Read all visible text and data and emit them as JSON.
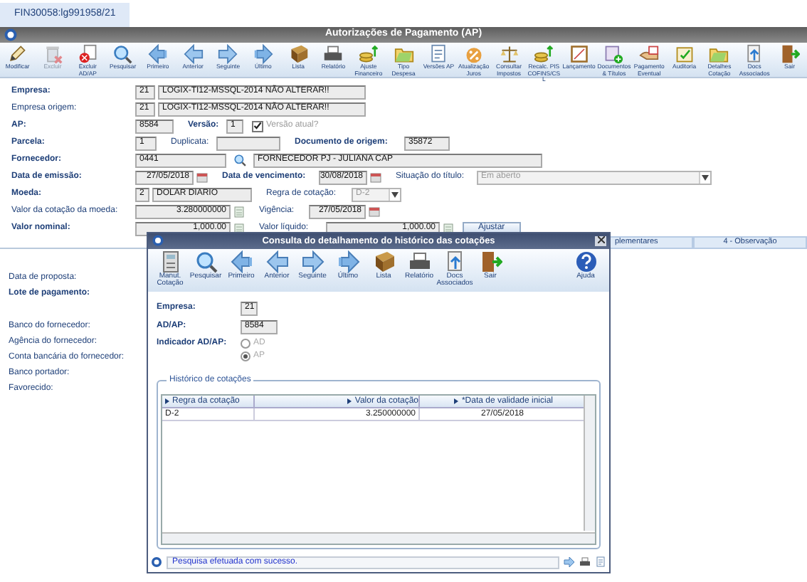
{
  "app_tab": {
    "label": "FIN30058:lg991958/21",
    "selected": true
  },
  "window": {
    "title": "Autorizações de Pagamento (AP)"
  },
  "toolbar": [
    {
      "label": "Modificar",
      "disabled": false
    },
    {
      "label": "Excluir",
      "disabled": true
    },
    {
      "label": "Excluir AD/AP",
      "disabled": false
    },
    {
      "label": "Pesquisar",
      "disabled": false
    },
    {
      "label": "Primeiro",
      "disabled": false
    },
    {
      "label": "Anterior",
      "disabled": false
    },
    {
      "label": "Seguinte",
      "disabled": false
    },
    {
      "label": "Último",
      "disabled": false
    },
    {
      "label": "Lista",
      "disabled": false
    },
    {
      "label": "Relatório",
      "disabled": false
    },
    {
      "label": "Ajuste Financeiro",
      "disabled": false
    },
    {
      "label": "Tipo Despesa",
      "disabled": false
    },
    {
      "label": "Versões AP",
      "disabled": false
    },
    {
      "label": "Atualização Juros",
      "disabled": false
    },
    {
      "label": "Consultar Impostos",
      "disabled": false
    },
    {
      "label": "Recalc. PIS COFINS/CSL",
      "disabled": false
    },
    {
      "label": "Lançamento",
      "disabled": false
    },
    {
      "label": "Documentos & Títulos",
      "disabled": false
    },
    {
      "label": "Pagamento Eventual",
      "disabled": false
    },
    {
      "label": "Auditoria",
      "disabled": false
    },
    {
      "label": "Detalhes Cotação",
      "disabled": false
    },
    {
      "label": "Docs Associados",
      "disabled": false
    },
    {
      "label": "Sair",
      "disabled": false
    }
  ],
  "form": [
    {
      "items": [
        {
          "kind": "label",
          "text": "Empresa:",
          "required": true
        },
        {
          "kind": "field",
          "value": "21"
        },
        {
          "kind": "field",
          "value": "LOGIX-TI12-MSSQL-2014 NÃO ALTERAR!!"
        }
      ]
    },
    {
      "items": [
        {
          "kind": "label",
          "text": "Empresa origem:",
          "required": false
        },
        {
          "kind": "field",
          "value": "21"
        },
        {
          "kind": "field",
          "value": "LOGIX-TI12-MSSQL-2014 NÃO ALTERAR!!"
        }
      ]
    },
    {
      "items": [
        {
          "kind": "label",
          "text": "AP:",
          "required": true
        },
        {
          "kind": "field",
          "value": "8584"
        },
        {
          "kind": "label",
          "text": "Versão:",
          "required": true
        },
        {
          "kind": "field",
          "value": "1"
        },
        {
          "kind": "checkbox",
          "checked": true
        },
        {
          "kind": "caption",
          "text": "Versão atual?",
          "disabled": true
        }
      ]
    },
    {
      "items": [
        {
          "kind": "label",
          "text": "Parcela:",
          "required": true
        },
        {
          "kind": "field",
          "value": "1"
        },
        {
          "kind": "label",
          "text": "Duplicata:",
          "required": false
        },
        {
          "kind": "field"
        },
        {
          "kind": "label",
          "text": "Documento de origem:",
          "required": true
        },
        {
          "kind": "field",
          "value": "35872"
        }
      ]
    },
    {
      "items": [
        {
          "kind": "label",
          "text": "Fornecedor:",
          "required": true
        },
        {
          "kind": "field",
          "value": "0441"
        },
        {
          "kind": "lookup"
        },
        {
          "kind": "field",
          "value": "FORNECEDOR PJ - JULIANA CAP"
        }
      ]
    },
    {
      "items": [
        {
          "kind": "label",
          "text": "Data de emissão:",
          "required": true
        },
        {
          "kind": "rfield",
          "value": "27/05/2018"
        },
        {
          "kind": "calendar"
        },
        {
          "kind": "label",
          "text": "Data de vencimento:",
          "required": true
        },
        {
          "kind": "rfield",
          "value": "30/08/2018"
        },
        {
          "kind": "calendar"
        },
        {
          "kind": "label",
          "text": "Situação do título:",
          "required": false
        },
        {
          "kind": "select",
          "value": "Em aberto",
          "disabled": true
        }
      ]
    },
    {
      "items": [
        {
          "kind": "label",
          "text": "Moeda:",
          "required": true
        },
        {
          "kind": "field",
          "value": "2"
        },
        {
          "kind": "field",
          "value": "DOLAR DIARIO"
        },
        {
          "kind": "label",
          "text": "Regra de cotação:",
          "required": false
        },
        {
          "kind": "select",
          "value": "D-2",
          "disabled": true
        }
      ]
    },
    {
      "items": [
        {
          "kind": "label",
          "text": "Valor da cotação da moeda:",
          "required": false
        },
        {
          "kind": "rfield",
          "value": "3.280000000"
        },
        {
          "kind": "calculator"
        },
        {
          "kind": "label",
          "text": "Vigência:",
          "required": false
        },
        {
          "kind": "rfield",
          "value": "27/05/2018"
        },
        {
          "kind": "calendar"
        }
      ]
    },
    {
      "items": [
        {
          "kind": "label",
          "text": "Valor nominal:",
          "required": true
        },
        {
          "kind": "rfield",
          "value": "1,000.00"
        },
        {
          "kind": "calculator"
        },
        {
          "kind": "label",
          "text": "Valor líquido:",
          "required": false
        },
        {
          "kind": "rfield",
          "value": "1,000.00"
        },
        {
          "kind": "calculator"
        },
        {
          "kind": "button",
          "text": "Ajustar"
        }
      ]
    }
  ],
  "tabs": [
    {
      "label": "plementares",
      "selected": false
    },
    {
      "label": "4 - Observação",
      "selected": false
    }
  ],
  "details": [
    {
      "text": "Data de proposta:",
      "required": false
    },
    {
      "text": "Lote de pagamento:",
      "required": true
    },
    {
      "text": "Banco do fornecedor:",
      "required": false
    },
    {
      "text": "Agência do fornecedor:",
      "required": false
    },
    {
      "text": "Conta bancária do fornecedor:",
      "required": false
    },
    {
      "text": "Banco portador:",
      "required": false
    },
    {
      "text": "Favorecido:",
      "required": false
    }
  ],
  "dialog": {
    "title": "Consulta do detalhamento do histórico das cotações",
    "toolbar": [
      {
        "label": "Manut. Cotação"
      },
      {
        "label": "Pesquisar"
      },
      {
        "label": "Primeiro"
      },
      {
        "label": "Anterior"
      },
      {
        "label": "Seguinte"
      },
      {
        "label": "Último"
      },
      {
        "label": "Lista"
      },
      {
        "label": "Relatório"
      },
      {
        "label": "Docs Associados"
      },
      {
        "label": "Sair"
      },
      {
        "label": "Ajuda"
      }
    ],
    "fields": [
      {
        "label": "Empresa:",
        "value": "21"
      },
      {
        "label": "AD/AP:",
        "value": "8584"
      }
    ],
    "indicator": {
      "label": "Indicador AD/AP:",
      "options": [
        {
          "label": "AD",
          "selected": false
        },
        {
          "label": "AP",
          "selected": true
        }
      ]
    },
    "history": {
      "title": "Histórico de cotações",
      "columns": [
        "Regra da cotação",
        "Valor da cotação",
        "*Data de validade inicial"
      ],
      "rows": [
        [
          "D-2",
          "3.250000000",
          "27/05/2018"
        ]
      ]
    },
    "status": "Pesquisa efetuada com sucesso."
  }
}
